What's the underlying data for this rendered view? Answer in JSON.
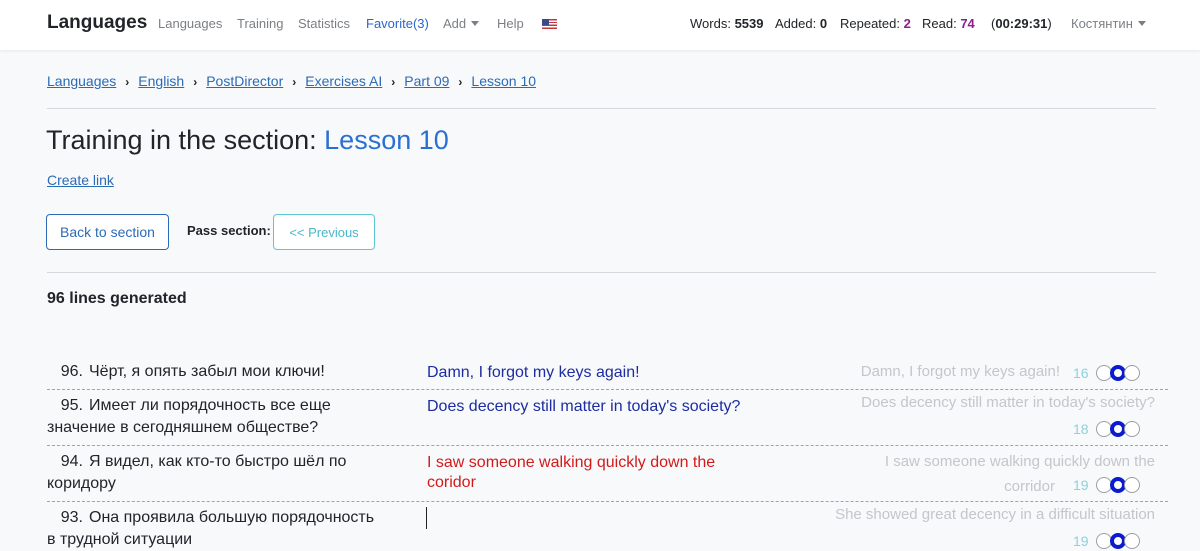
{
  "nav": {
    "brand": "Languages",
    "links": {
      "languages": "Languages",
      "training": "Training",
      "statistics": "Statistics",
      "favorite": "Favorite(3)",
      "add": "Add",
      "help": "Help"
    },
    "stats": {
      "words_label": "Words:",
      "words": "5539",
      "added_label": "Added:",
      "added": "0",
      "repeated_label": "Repeated:",
      "repeated": "2",
      "read_label": "Read:",
      "read": "74",
      "timer": "00:29:31"
    },
    "user": "Костянтин"
  },
  "breadcrumb": [
    "Languages",
    "English",
    "PostDirector",
    "Exercises AI",
    "Part 09",
    "Lesson 10"
  ],
  "page": {
    "title_prefix": "Training in the section: ",
    "title_accent": "Lesson 10",
    "create_link": "Create link",
    "back_button": "Back to section",
    "pass_label": "Pass section:",
    "prev_button": "<< Previous",
    "generated": "96 lines generated"
  },
  "rows": [
    {
      "num": "96.",
      "ru": "Чёрт, я опять забыл мои ключи!",
      "answer": "Damn, I forgot my keys again!",
      "status": "correct",
      "hint": "Damn, I forgot my keys again!",
      "count": "16"
    },
    {
      "num": "95.",
      "ru": "Имеет ли порядочность все еще значение в сегодняшнем обществе?",
      "answer": "Does decency still matter in today's society?",
      "status": "correct",
      "hint": "Does decency still matter in today's society?",
      "count": "18"
    },
    {
      "num": "94.",
      "ru": "Я видел, как кто-то быстро шёл по коридору",
      "answer": "I saw someone walking quickly down the coridor",
      "status": "error",
      "hint": "I saw someone walking quickly down the corridor",
      "count": "19"
    },
    {
      "num": "93.",
      "ru": "Она проявила большую порядочность в трудной ситуации",
      "answer": "",
      "status": "pending",
      "hint": "She showed great decency in a difficult situation",
      "count": "19"
    }
  ],
  "colors": {
    "accent": "#2b6fd1",
    "answer_correct": "#1d2ca0",
    "answer_error": "#d11b1b",
    "toggle_active": "#0a1bd1"
  }
}
